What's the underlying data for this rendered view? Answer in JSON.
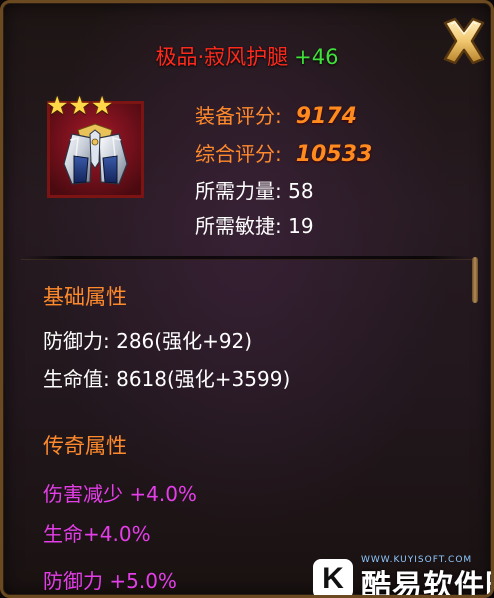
{
  "title": {
    "name": "极品·寂风护腿",
    "enhance": "+46"
  },
  "item": {
    "stars": 3,
    "star_glyph": "★",
    "icon": "armor-leg-icon"
  },
  "stats": {
    "equip_score_label": "装备评分:",
    "equip_score": "9174",
    "total_score_label": "综合评分:",
    "total_score": "10533",
    "req_str": "所需力量: 58",
    "req_agi": "所需敏捷: 19"
  },
  "base": {
    "title": "基础属性",
    "lines": [
      "防御力: 286(强化+92)",
      "生命值: 8618(强化+3599)"
    ]
  },
  "legend": {
    "title": "传奇属性",
    "lines": [
      "伤害减少 +4.0%",
      "生命+4.0%",
      "防御力 +5.0%"
    ]
  },
  "watermark": {
    "logo_letter": "K",
    "text": "酷易软件园",
    "url": "WWW.KUYISOFT.COM"
  },
  "colors": {
    "title": "#ff2a1c",
    "enhance": "#3fe23a",
    "section": "#ff8a2c",
    "legend_text": "#e43ee8",
    "score": "#ff8a1e",
    "frame": "#6b4a22"
  }
}
